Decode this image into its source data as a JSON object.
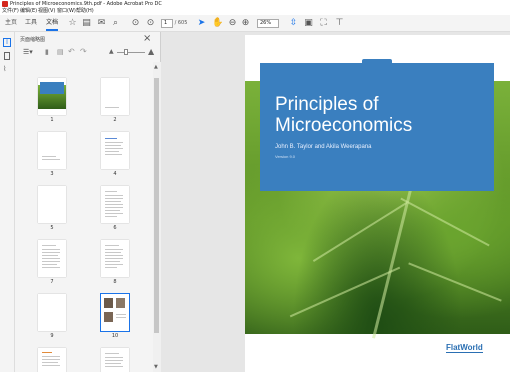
{
  "window": {
    "title": "Principles of Microeconomics.9th.pdf - Adobe Acrobat Pro DC"
  },
  "menu": [
    "文件(F)",
    "编辑(E)",
    "视图(V)",
    "窗口(W)",
    "帮助(H)"
  ],
  "tabs": {
    "home": "主页",
    "tools": "工具",
    "document": "文档"
  },
  "toolbar": {
    "page_current": "1",
    "page_total": "/ 605",
    "zoom": "26%"
  },
  "sidebar": {
    "header": "页面缩略图",
    "close": "×"
  },
  "thumbnails": [
    {
      "label": "1"
    },
    {
      "label": "2"
    },
    {
      "label": "3"
    },
    {
      "label": "4"
    },
    {
      "label": "5"
    },
    {
      "label": "6"
    },
    {
      "label": "7"
    },
    {
      "label": "8"
    },
    {
      "label": "9"
    },
    {
      "label": "10"
    }
  ],
  "cover": {
    "title_line1": "Principles of",
    "title_line2": "Microeconomics",
    "authors": "John B. Taylor and Akila Weerapana",
    "version": "Version 9.0",
    "publisher": "FlatWorld"
  },
  "colors": {
    "banner": "#3a7fbf",
    "accent": "#1a73e8",
    "leaf": "#6aa42e"
  },
  "icons": [
    "pdf-icon",
    "star-icon",
    "upload-icon",
    "print-icon",
    "mail-icon",
    "search-icon",
    "page-up-icon",
    "page-down-icon",
    "select-cursor-icon",
    "hand-icon",
    "zoom-out-icon",
    "zoom-in-icon",
    "fit-icon",
    "scroll-mode-icon",
    "fullscreen-icon",
    "comment-icon"
  ]
}
